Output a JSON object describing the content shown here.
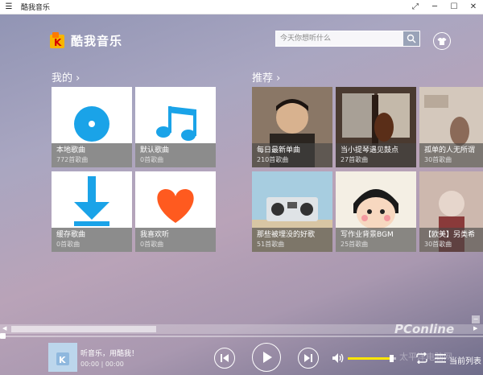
{
  "window": {
    "title": "酷我音乐"
  },
  "app": {
    "logo_text": "酷我音乐"
  },
  "search": {
    "placeholder": "今天你想听什么"
  },
  "my_section": {
    "title": "我的 ›",
    "tiles": [
      {
        "name": "本地歌曲",
        "count": "772首歌曲",
        "icon": "disc-icon"
      },
      {
        "name": "默认歌曲",
        "count": "0首歌曲",
        "icon": "music-note-icon"
      },
      {
        "name": "缓存歌曲",
        "count": "0首歌曲",
        "icon": "download-arrow-icon"
      },
      {
        "name": "我喜欢听",
        "count": "0首歌曲",
        "icon": "heart-icon"
      }
    ]
  },
  "recommend_section": {
    "title": "推荐 ›",
    "tiles": [
      {
        "name": "每日最新单曲",
        "count": "210首歌曲"
      },
      {
        "name": "当小提琴遇见鼓点",
        "count": "27首歌曲"
      },
      {
        "name": "孤单的人无所谓",
        "count": "30首歌曲"
      },
      {
        "name": "那些被埋没的好歌",
        "count": "51首歌曲"
      },
      {
        "name": "写作业背景BGM",
        "count": "25首歌曲"
      },
      {
        "name": "【欧美】另类希",
        "count": "30首歌曲"
      }
    ]
  },
  "player": {
    "now_playing": "听音乐，用酷我！",
    "time": "00:00 | 00:00",
    "volume_fraction": 0.9,
    "playlist_label": "当前列表"
  },
  "watermark": {
    "text": "PConline",
    "subtext": "太平洋电脑网"
  },
  "colors": {
    "accent_blue": "#1aa3e8",
    "heart_orange": "#ff5a1f",
    "volume_yellow": "#ffe600"
  }
}
